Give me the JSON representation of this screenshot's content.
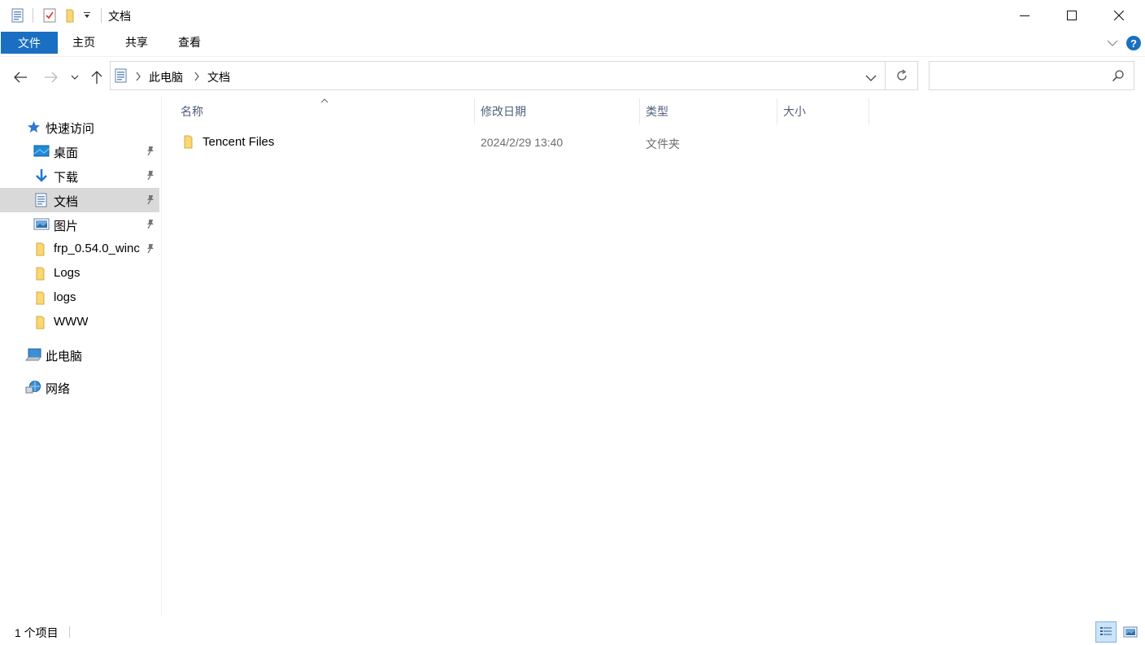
{
  "window": {
    "title": "文档",
    "minimize_icon": "minimize-icon",
    "maximize_icon": "maximize-icon",
    "close_icon": "close-icon"
  },
  "ribbon": {
    "tabs": [
      {
        "label": "文件"
      },
      {
        "label": "主页"
      },
      {
        "label": "共享"
      },
      {
        "label": "查看"
      }
    ]
  },
  "address": {
    "crumbs": [
      "此电脑",
      "文档"
    ],
    "search_placeholder": ""
  },
  "sidebar": {
    "quick_access": "快速访问",
    "items": [
      {
        "label": "桌面",
        "pinned": true
      },
      {
        "label": "下载",
        "pinned": true
      },
      {
        "label": "文档",
        "pinned": true,
        "selected": true
      },
      {
        "label": "图片",
        "pinned": true
      },
      {
        "label": "frp_0.54.0_winc",
        "pinned": true
      },
      {
        "label": "Logs",
        "pinned": false
      },
      {
        "label": "logs",
        "pinned": false
      },
      {
        "label": "WWW",
        "pinned": false
      }
    ],
    "this_pc": "此电脑",
    "network": "网络"
  },
  "columns": {
    "name": "名称",
    "modified": "修改日期",
    "type": "类型",
    "size": "大小"
  },
  "files": [
    {
      "name": "Tencent Files",
      "modified": "2024/2/29 13:40",
      "type": "文件夹",
      "size": ""
    }
  ],
  "status": {
    "count": "1 个项目"
  },
  "colors": {
    "accent": "#1a6fc2",
    "folder": "#f8d775",
    "selection": "#d9d9d9",
    "header_text": "#4c607a"
  }
}
